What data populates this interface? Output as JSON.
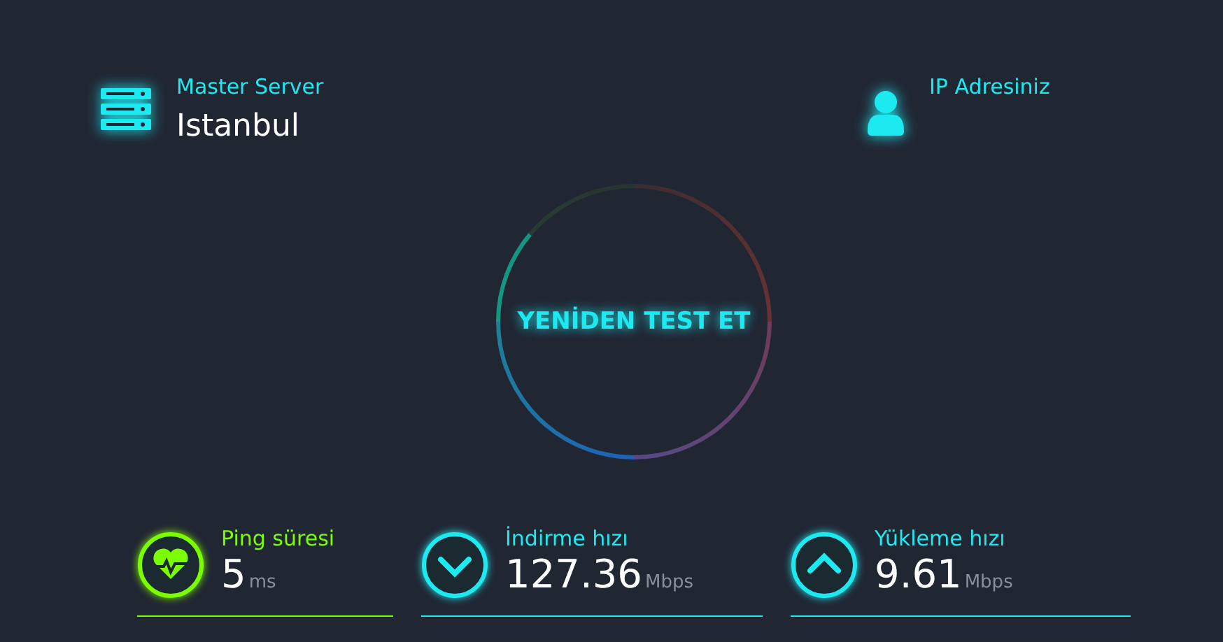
{
  "server": {
    "label": "Master Server",
    "city": "Istanbul"
  },
  "ip": {
    "label": "IP Adresiniz"
  },
  "test_button": {
    "label": "YENİDEN TEST ET"
  },
  "stats": [
    {
      "kind": "ping",
      "label": "Ping süresi",
      "value": "5",
      "unit": "ms",
      "color": "#7cfc00"
    },
    {
      "kind": "download",
      "label": "İndirme hızı",
      "value": "127.36",
      "unit": "Mbps",
      "color": "#1de9f0"
    },
    {
      "kind": "upload",
      "label": "Yükleme hızı",
      "value": "9.61",
      "unit": "Mbps",
      "color": "#1de9f0"
    }
  ]
}
